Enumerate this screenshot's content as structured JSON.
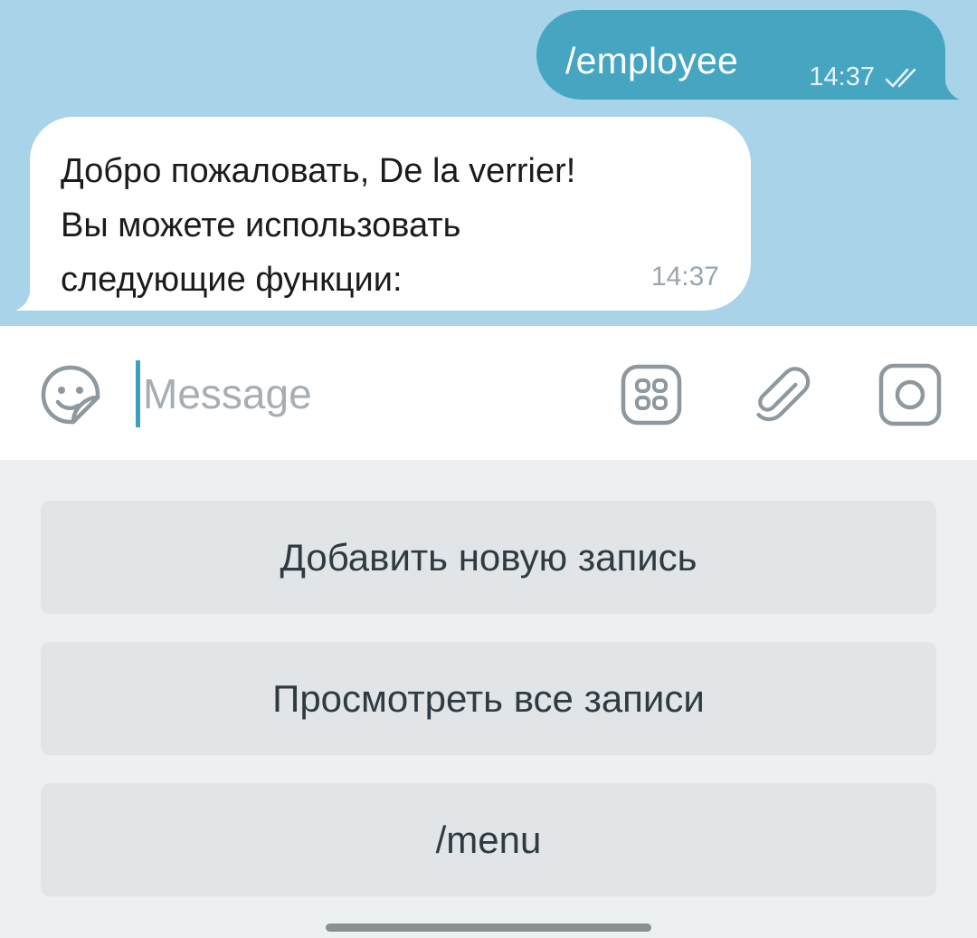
{
  "chat": {
    "outgoing": {
      "text": "/employee",
      "time": "14:37",
      "status_icon": "double-check-icon"
    },
    "incoming": {
      "text": "Добро пожаловать, De la verrier!\nВы можете использовать\nследующие функции:",
      "time": "14:37"
    }
  },
  "input_bar": {
    "placeholder": "Message",
    "icons": [
      "sticker-icon",
      "bot-keyboard-icon",
      "paperclip-icon",
      "camera-icon"
    ]
  },
  "keyboard": {
    "buttons": [
      {
        "label": "Добавить новую запись"
      },
      {
        "label": "Просмотреть все записи"
      },
      {
        "label": "/menu"
      }
    ]
  },
  "colors": {
    "chat_background": "#a8d3e8",
    "outgoing_bubble": "#46a6c2",
    "incoming_bubble": "#ffffff",
    "accent": "#3fa0bd",
    "keyboard_background": "#edf0f2",
    "keyboard_button": "#e1e5e7"
  }
}
